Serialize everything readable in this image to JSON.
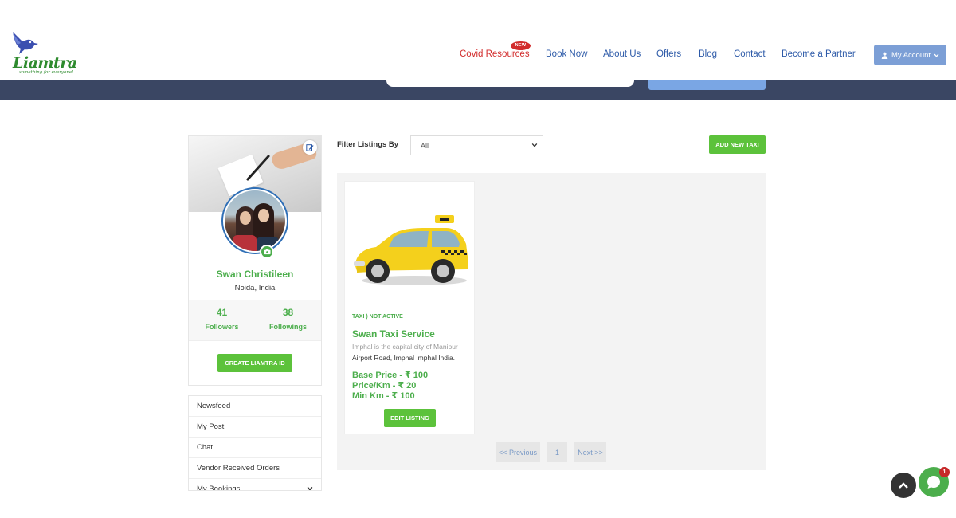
{
  "brand": {
    "logo_text": "Liamtra",
    "tagline": "something for everyone!"
  },
  "header": {
    "nav": {
      "covid": "Covid Resources",
      "covid_badge": "NEW",
      "book_now": "Book Now",
      "about_us": "About Us",
      "offers": "Offers",
      "blog": "Blog",
      "contact": "Contact",
      "partner": "Become a Partner"
    },
    "account_label": "My Account"
  },
  "profile": {
    "name": "Swan Christileen",
    "location": "Noida, India",
    "followers_count": "41",
    "followers_label": "Followers",
    "followings_count": "38",
    "followings_label": "Followings",
    "create_id_label": "CREATE LIAMTRA ID"
  },
  "menu": {
    "items": [
      "Newsfeed",
      "My Post",
      "Chat",
      "Vendor Received Orders",
      "My Bookings"
    ]
  },
  "filter": {
    "label": "Filter Listings By",
    "selected": "All",
    "add_label": "ADD NEW TAXI"
  },
  "listing": {
    "category": "TAXI ) NOT ACTIVE",
    "title": "Swan Taxi Service",
    "description": "Imphal is the capital city of Manipur",
    "address": "Airport Road, Imphal Imphal India.",
    "base_price": "Base Price - ₹ 100",
    "price_km": "Price/Km - ₹ 20",
    "min_km": "Min Km - ₹ 100",
    "edit_label": "EDIT LISTING"
  },
  "pagination": {
    "prev": "<< Previous",
    "page": "1",
    "next": "Next >>"
  },
  "chat": {
    "badge_count": "1"
  },
  "colors": {
    "brand_green": "#4cae4c",
    "button_green": "#5cc23b",
    "nav_blue": "#2d5aa8",
    "covid_red": "#d22c2c",
    "band_navy": "#3a4663",
    "account_blue": "#7c9fd6"
  }
}
